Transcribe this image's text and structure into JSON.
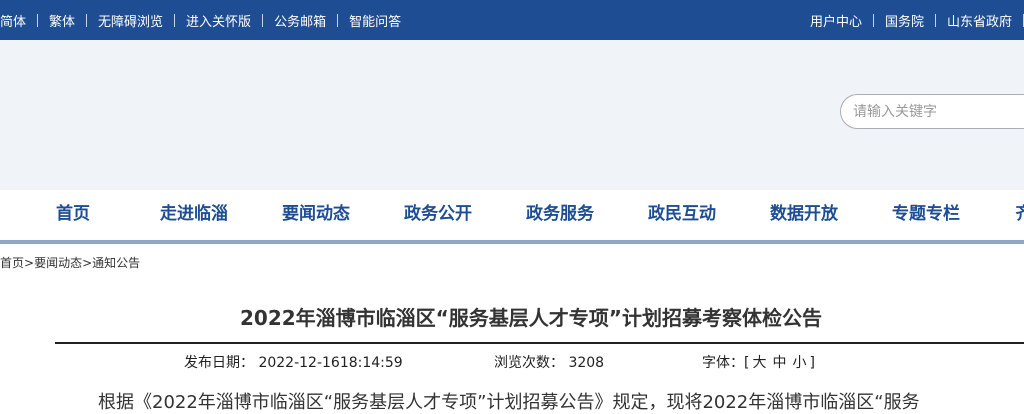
{
  "topbar": {
    "left_links": [
      "简体",
      "繁体",
      "无障碍浏览",
      "进入关怀版",
      "公务邮箱",
      "智能问答"
    ],
    "right_links": [
      "用户中心",
      "国务院",
      "山东省政府"
    ]
  },
  "search": {
    "placeholder": "请输入关键字"
  },
  "nav": {
    "items": [
      "首页",
      "走进临淄",
      "要闻动态",
      "政务公开",
      "政务服务",
      "政民互动",
      "数据开放",
      "专题专栏",
      "齐"
    ]
  },
  "breadcrumb": {
    "items": [
      "首页",
      "要闻动态",
      "通知公告"
    ],
    "separator": ">"
  },
  "article": {
    "title": "2022年淄博市临淄区“服务基层人才专项”计划招募考察体检公告",
    "publish_label": "发布日期：",
    "publish_value": "2022-12-1618:14:59",
    "views_label": "浏览次数：",
    "views_value": "3208",
    "font_label": "字体：",
    "font_open": "[",
    "font_large": "大",
    "font_medium": "中",
    "font_small": "小",
    "font_close": "]",
    "body_first_line": "根据《2022年淄博市临淄区“服务基层人才专项”计划招募公告》规定，现将2022年淄博市临淄区“服务"
  },
  "colors": {
    "topbar_bg": "#1f4d93",
    "nav_text": "#1f4d93",
    "banner_bg": "#f0f3f8",
    "nav_underline": "#8fa6c4"
  }
}
